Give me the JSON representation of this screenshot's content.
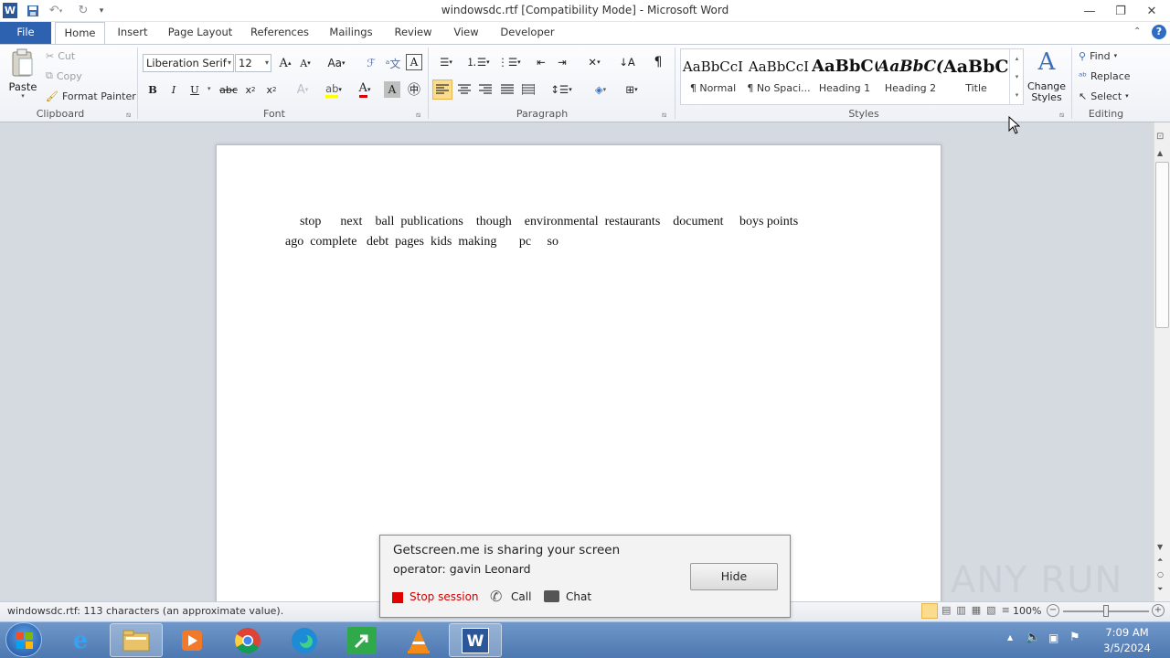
{
  "window": {
    "title": "windowsdc.rtf [Compatibility Mode] - Microsoft Word"
  },
  "tabs": [
    "File",
    "Home",
    "Insert",
    "Page Layout",
    "References",
    "Mailings",
    "Review",
    "View",
    "Developer"
  ],
  "clipboard": {
    "paste": "Paste",
    "cut": "Cut",
    "copy": "Copy",
    "format_painter": "Format Painter",
    "group_label": "Clipboard"
  },
  "font": {
    "name": "Liberation Serif",
    "size": "12",
    "group_label": "Font",
    "bold": "B",
    "italic": "I",
    "underline": "U"
  },
  "paragraph": {
    "group_label": "Paragraph"
  },
  "styles": {
    "group_label": "Styles",
    "items": [
      {
        "preview": "AaBbCcI",
        "name": "¶ Normal"
      },
      {
        "preview": "AaBbCcI",
        "name": "¶ No Spaci..."
      },
      {
        "preview": "AaBbC(",
        "name": "Heading 1"
      },
      {
        "preview": "AaBbC(",
        "name": "Heading 2"
      },
      {
        "preview": "AaBbC(",
        "name": "Title"
      }
    ],
    "change_styles": "Change Styles"
  },
  "editing": {
    "find": "Find",
    "replace": "Replace",
    "select": "Select",
    "group_label": "Editing"
  },
  "document": {
    "lines": [
      "stop      next    ball  publications    though    environmental  restaurants    document     boys points",
      "ago  complete   debt  pages  kids  making       pc     so"
    ]
  },
  "status": {
    "text": "windowsdc.rtf: 113 characters (an approximate value).",
    "zoom": "100%"
  },
  "popup": {
    "title": "Getscreen.me is sharing your screen",
    "operator": "operator: gavin Leonard",
    "stop": "Stop session",
    "call": "Call",
    "chat": "Chat",
    "hide": "Hide"
  },
  "watermark": "ANY RUN",
  "clock": {
    "time": "7:09 AM",
    "date": "3/5/2024"
  },
  "colors": {
    "file_tab": "#2c62b0",
    "taskbar": "#5a84bb",
    "stop_red": "#e00000"
  }
}
